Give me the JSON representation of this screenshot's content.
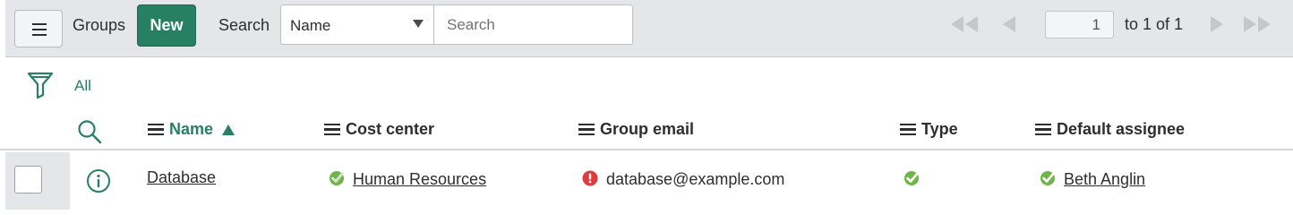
{
  "header": {
    "menu_icon": "hamburger-icon",
    "title": "Groups",
    "new_label": "New",
    "search_label": "Search",
    "search_field": "Name",
    "search_placeholder": "Search",
    "pager": {
      "current_page": "1",
      "range_text": "to 1 of 1"
    },
    "accent_color": "#278062"
  },
  "filter": {
    "icon": "funnel-icon",
    "breadcrumb": "All"
  },
  "columns": [
    {
      "label": "Name",
      "sorted": "ascending"
    },
    {
      "label": "Cost center"
    },
    {
      "label": "Group email"
    },
    {
      "label": "Type"
    },
    {
      "label": "Default assignee"
    }
  ],
  "rows": [
    {
      "name": "Database",
      "cost_center": "Human Resources",
      "cost_center_status": "valid",
      "group_email": "database@example.com",
      "group_email_status": "invalid",
      "type_status": "valid",
      "default_assignee": "Beth Anglin",
      "default_assignee_status": "valid"
    }
  ]
}
